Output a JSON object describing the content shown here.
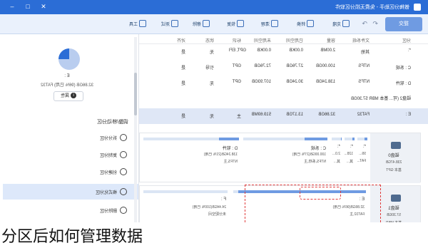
{
  "window": {
    "title": "傲梅分区助手 - 免费无损分区软件",
    "controls": [
      "–",
      "□",
      "✕"
    ]
  },
  "toolbar": {
    "apply_label": "提交",
    "items": [
      {
        "label": "工具",
        "icon": "tools-icon"
      },
      {
        "label": "测试",
        "icon": "test-icon"
      },
      {
        "label": "擦除",
        "icon": "wipe-icon"
      },
      {
        "label": "恢复",
        "icon": "recover-icon"
      },
      {
        "label": "清理",
        "icon": "clean-icon"
      },
      {
        "label": "转换",
        "icon": "convert-icon"
      },
      {
        "label": "克隆",
        "icon": "clone-icon"
      }
    ]
  },
  "table": {
    "headers": [
      "分区",
      "文件系统",
      "容量",
      "已用空间",
      "未用空间",
      "标识",
      "状态",
      "对齐"
    ],
    "rows": [
      {
        "partition": "*:",
        "fs": "其他",
        "capacity": "2.00MB",
        "used": "0.00KB",
        "free": "0.00KB",
        "flag": "GPT, EFI",
        "status": "无",
        "align": "是"
      },
      {
        "partition": "C : 系统",
        "fs": "NTFS",
        "capacity": "100.00GB",
        "used": "27.76GB",
        "free": "72.76GB",
        "flag": "GPT",
        "status": "引导",
        "align": "是"
      },
      {
        "partition": "D : 软件",
        "fs": "NTFS",
        "capacity": "138.24GB",
        "used": "30.24GB",
        "free": "107.93GB",
        "flag": "GPT",
        "status": "无",
        "align": "是"
      },
      {
        "partition": "E :",
        "fs": "FAT32",
        "capacity": "32.86GB",
        "used": "13.17GB",
        "free": "519.69MB",
        "flag": "主",
        "status": "无",
        "align": "是"
      }
    ],
    "disk2_label": "磁盘2 (可...  基本 MBR  57.30GB"
  },
  "disk1": {
    "name": "磁盘0",
    "size": "238.47GB",
    "type": "基本 GPT",
    "partitions": [
      {
        "name": "*:",
        "size": "99...",
        "fs": "FAT...",
        "fill": 0.3
      },
      {
        "name": "*:",
        "size": "128...",
        "fs": "其...",
        "fill": 0.2
      },
      {
        "name": "*:",
        "size": "2.0...",
        "fs": "其...",
        "fill": 0.1
      },
      {
        "name": "C : 系统",
        "size": "100.00GB(27% 已用)",
        "fs": "NTFS,系统,主",
        "fill": 0.27
      },
      {
        "name": "D : 软件",
        "size": "138.24GB(21% 已用)",
        "fs": "NTFS,主",
        "fill": 0.21
      }
    ]
  },
  "disk2": {
    "name": "磁盘1",
    "size": "57.30GB",
    "type": "基本 MBR",
    "partitions": [
      {
        "name": "E :",
        "size": "32.86GB(96% 已用)",
        "fs": "FAT32,主",
        "fill": 0.96
      },
      {
        "name": "F :",
        "size": "24.44GB(100% 已用)",
        "fs": "未分配空间",
        "fill": 0.0
      }
    ]
  },
  "sidebar": {
    "drive_name": "E :",
    "drive_info": "32.86GB (96% 已用) FAT32",
    "properties_label": "属性",
    "section_title": "调整/移动分区",
    "items": [
      {
        "label": "调整/移动分区",
        "icon": "resize-icon"
      },
      {
        "label": "拆分分区",
        "icon": "split-icon"
      },
      {
        "label": "复制分区",
        "icon": "copy-icon"
      },
      {
        "label": "创建分区",
        "icon": "create-icon"
      },
      {
        "label": "格式化分区",
        "icon": "format-icon"
      },
      {
        "label": "删除分区",
        "icon": "delete-icon"
      }
    ]
  },
  "caption": "分区后如何管理数据"
}
